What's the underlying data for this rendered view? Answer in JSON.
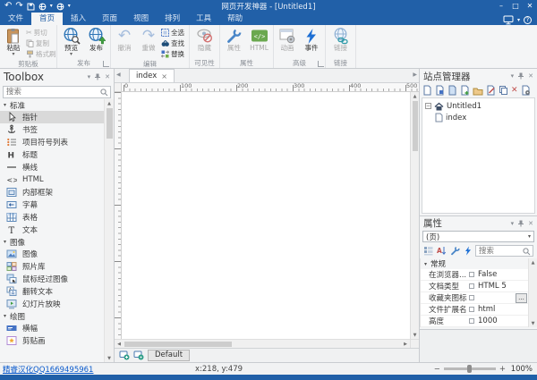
{
  "window": {
    "title": "网页开发神器 - [Untitled1]"
  },
  "menu_tabs": {
    "file": "文件",
    "home": "首页",
    "insert": "插入",
    "page": "页面",
    "view": "视图",
    "arrange": "排列",
    "tools": "工具",
    "help": "帮助"
  },
  "ribbon": {
    "paste": "粘贴",
    "cut": "剪切",
    "copy": "复制",
    "format_painter": "格式刷",
    "clipboard_group": "剪贴板",
    "preview": "预览",
    "publish": "发布",
    "publish_group": "发布",
    "undo": "撤消",
    "redo": "重做",
    "select_all": "全选",
    "find": "查找",
    "replace": "替换",
    "edit_group": "编辑",
    "hide": "隐藏",
    "visibility_group": "可见性",
    "properties": "属性",
    "html": "HTML",
    "properties_group": "属性",
    "animation": "动画",
    "events": "事件",
    "advanced_group": "高级",
    "link": "链接",
    "link_group": "链接"
  },
  "toolbox": {
    "title": "Toolbox",
    "search_placeholder": "搜索",
    "sections": {
      "standard": "标准",
      "images": "图像",
      "drawing": "绘图"
    },
    "items": {
      "pointer": "指针",
      "bookmark": "书签",
      "bulleted_list": "项目符号列表",
      "heading": "标题",
      "horizontal_line": "横线",
      "html": "HTML",
      "iframe": "内部框架",
      "marquee": "字幕",
      "table": "表格",
      "text": "文本",
      "image": "图像",
      "photo_gallery": "照片库",
      "rollover_image": "鼠标经过图像",
      "rollover_text": "翻转文本",
      "slideshow": "幻灯片放映",
      "banner": "横幅",
      "clipart": "剪贴画"
    }
  },
  "editor": {
    "doc_tab": "index",
    "ruler_marks": [
      "0",
      "100",
      "200",
      "300",
      "400",
      "500"
    ],
    "default_tab": "Default"
  },
  "site_manager": {
    "title": "站点管理器",
    "root": "Untitled1",
    "child": "index"
  },
  "props": {
    "title": "属性",
    "selector": "(页)",
    "search_placeholder": "搜索",
    "section": "常规",
    "rows": [
      {
        "name": "在浏览器...",
        "value": "False"
      },
      {
        "name": "文档类型",
        "value": "HTML 5"
      },
      {
        "name": "收藏夹图标",
        "value": ""
      },
      {
        "name": "文件扩展名",
        "value": "html"
      },
      {
        "name": "高度",
        "value": "1000"
      }
    ]
  },
  "status": {
    "credit": "精睿汉化QQ1669495961",
    "coords": "x:218, y:479",
    "zoom": "100%"
  },
  "icons": {
    "undo": "↶",
    "redo": "↷",
    "dropdown": "▾",
    "minimize": "–",
    "maximize": "□",
    "close": "✕",
    "help": "?",
    "chevron_down": "▾",
    "panel_close": "✕",
    "section_tri": "▾",
    "scroll_up": "▲",
    "scroll_down": "▼",
    "scroll_left": "◀",
    "scroll_right": "▶",
    "tree_collapse": "−",
    "minus": "−",
    "plus": "+",
    "ellipsis": "...",
    "cut": "✂",
    "doc_tab_close": "×",
    "delete_x": "✕",
    "launcher": "◿"
  },
  "colors": {
    "titlebar": "#2160a8",
    "accent": "#2b579a",
    "link": "#0b5bcd",
    "ribbon_bg": "#f4f5f6"
  }
}
